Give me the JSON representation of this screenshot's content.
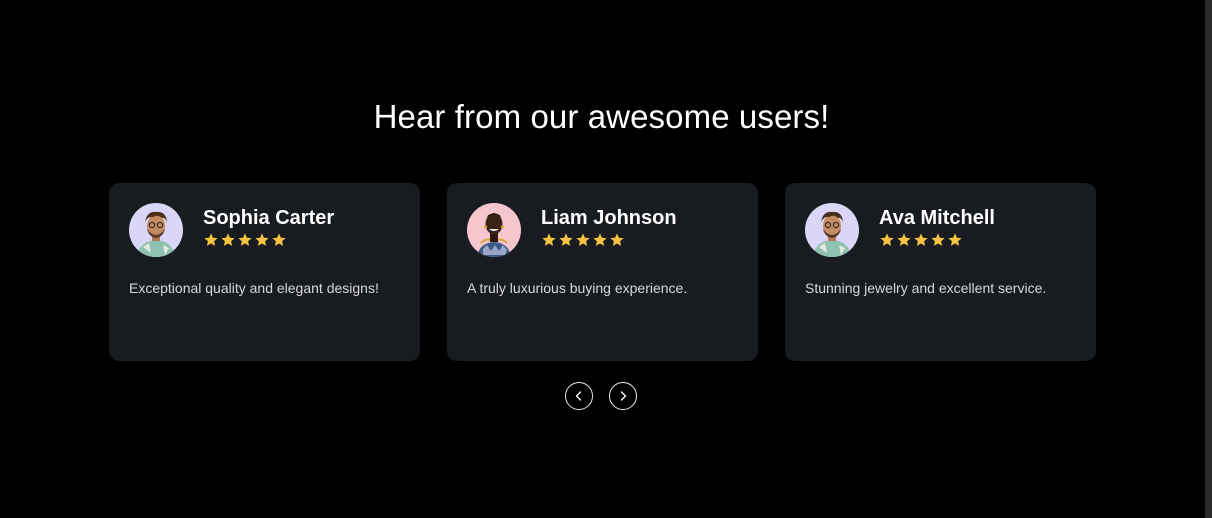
{
  "section": {
    "title": "Hear from our awesome users!"
  },
  "testimonials": [
    {
      "name": "Sophia Carter",
      "rating": 5,
      "quote": "Exceptional quality and elegant designs!",
      "avatar_bg": "#d9d6f7"
    },
    {
      "name": "Liam Johnson",
      "rating": 5,
      "quote": "A truly luxurious buying experience.",
      "avatar_bg": "#f6c6cf"
    },
    {
      "name": "Ava Mitchell",
      "rating": 5,
      "quote": "Stunning jewelry and excellent service.",
      "avatar_bg": "#d9d6f7"
    }
  ],
  "colors": {
    "background": "#000000",
    "card": "#181b1f",
    "star": "#f5c542",
    "text": "#ffffff"
  },
  "carousel": {
    "prev_icon": "chevron-left-icon",
    "next_icon": "chevron-right-icon"
  }
}
